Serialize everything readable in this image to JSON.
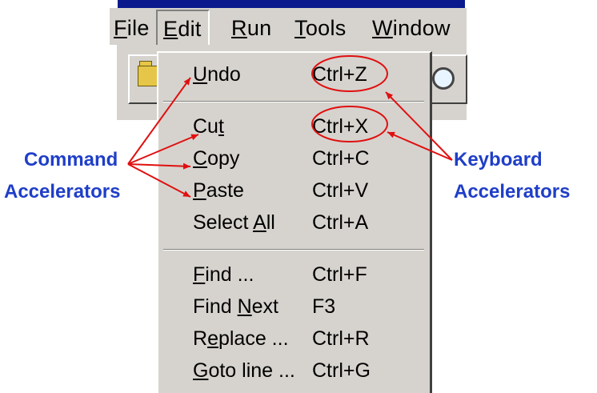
{
  "menubar": {
    "items": [
      {
        "label": "File",
        "mnemonic": "F"
      },
      {
        "label": "Edit",
        "mnemonic": "E"
      },
      {
        "label": "Run",
        "mnemonic": "R"
      },
      {
        "label": "Tools",
        "mnemonic": "T"
      },
      {
        "label": "Window",
        "mnemonic": "W"
      }
    ]
  },
  "edit_menu": {
    "groups": [
      [
        {
          "label": "Undo",
          "mnemonic": "U",
          "shortcut": "Ctrl+Z"
        }
      ],
      [
        {
          "label": "Cut",
          "mnemonic": "t",
          "shortcut": "Ctrl+X"
        },
        {
          "label": "Copy",
          "mnemonic": "C",
          "shortcut": "Ctrl+C"
        },
        {
          "label": "Paste",
          "mnemonic": "P",
          "shortcut": "Ctrl+V"
        },
        {
          "label": "Select All",
          "mnemonic": "A",
          "shortcut": "Ctrl+A"
        }
      ],
      [
        {
          "label": "Find ...",
          "mnemonic": "F",
          "shortcut": "Ctrl+F"
        },
        {
          "label": "Find Next",
          "mnemonic": "N",
          "shortcut": "F3"
        },
        {
          "label": "Replace ...",
          "mnemonic": "e",
          "shortcut": "Ctrl+R"
        },
        {
          "label": "Goto line ...",
          "mnemonic": "G",
          "shortcut": "Ctrl+G"
        }
      ]
    ]
  },
  "annotations": {
    "command": {
      "line1": "Command",
      "line2": "Accelerators"
    },
    "keyboard": {
      "line1": "Keyboard",
      "line2": "Accelerators"
    }
  },
  "colors": {
    "annotation_text": "#1f3ec8",
    "arrow": "#e01010",
    "menu_face": "#d6d3ce",
    "title_bar": "#0a1a8c"
  },
  "icons": [
    "folder-icon",
    "magnifier-icon"
  ]
}
